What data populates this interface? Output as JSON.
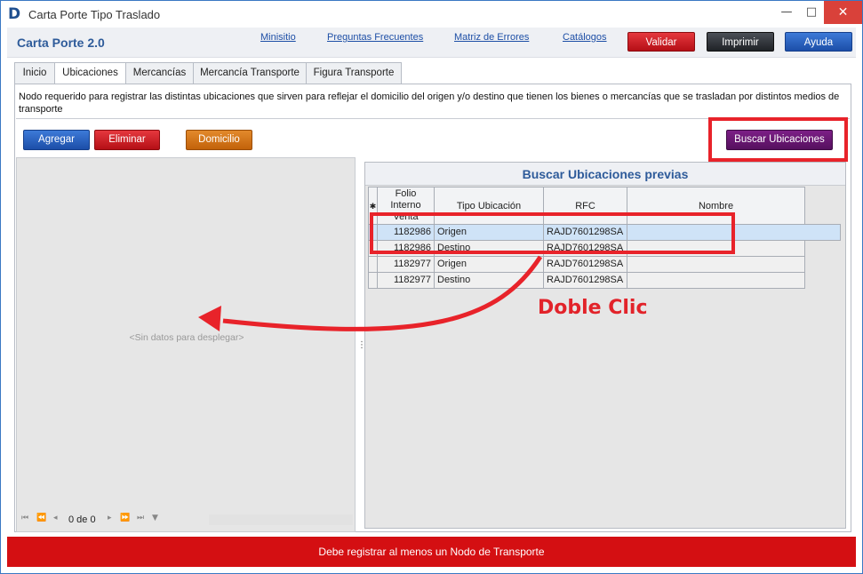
{
  "window": {
    "title": "Carta Porte Tipo Traslado",
    "logo": "D",
    "minimize": "—",
    "maximize": "□",
    "close": "✕"
  },
  "header": {
    "app_name": "Carta Porte 2.0",
    "links": [
      "Minisitio",
      "Preguntas Frecuentes",
      "Matriz de Errores",
      "Catálogos"
    ],
    "buttons": {
      "validar": "Validar",
      "imprimir": "Imprimir",
      "ayuda": "Ayuda"
    }
  },
  "tabs": [
    {
      "label": "Inicio",
      "active": false
    },
    {
      "label": "Ubicaciones",
      "active": true
    },
    {
      "label": "Mercancías",
      "active": false
    },
    {
      "label": "Mercancía Transporte",
      "active": false
    },
    {
      "label": "Figura Transporte",
      "active": false
    }
  ],
  "description": "Nodo requerido para registrar las distintas ubicaciones que sirven para reflejar el domicilio del origen y/o destino que tienen los bienes o mercancías que se trasladan por distintos medios de transporte",
  "actions": {
    "agregar": "Agregar",
    "eliminar": "Eliminar",
    "domicilio": "Domicilio",
    "buscar": "Buscar Ubicaciones"
  },
  "left_panel": {
    "empty_message": "<Sin datos para desplegar>",
    "pager_count": "0 de 0"
  },
  "search_panel": {
    "title": "Buscar Ubicaciones previas",
    "columns": [
      "Folio\nInterno\nVenta",
      "Tipo Ubicación",
      "RFC",
      "Nombre"
    ],
    "rows": [
      {
        "folio": "1182986",
        "tipo": "Origen",
        "rfc": "RAJD7601298SA",
        "nombre": "",
        "selected": true
      },
      {
        "folio": "1182986",
        "tipo": "Destino",
        "rfc": "RAJD7601298SA",
        "nombre": "",
        "selected": false
      },
      {
        "folio": "1182977",
        "tipo": "Origen",
        "rfc": "RAJD7601298SA",
        "nombre": "",
        "selected": false
      },
      {
        "folio": "1182977",
        "tipo": "Destino",
        "rfc": "RAJD7601298SA",
        "nombre": "",
        "selected": false
      }
    ]
  },
  "annotation": {
    "text": "Doble Clic",
    "color": "#e2232a"
  },
  "status": {
    "message": "Debe registrar al menos un Nodo de Transporte",
    "color": "#d40f12"
  }
}
